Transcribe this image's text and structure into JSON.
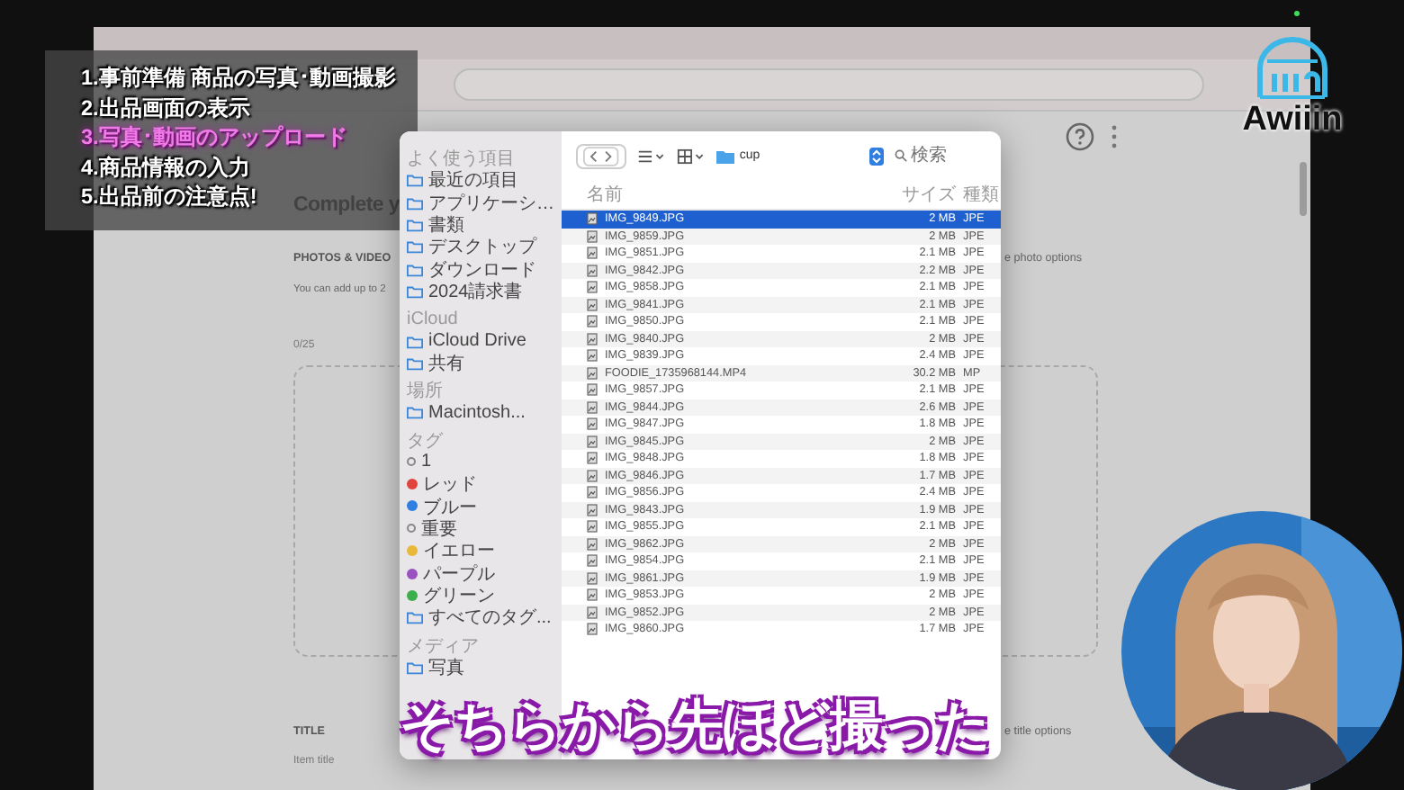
{
  "topics": [
    {
      "label": "1.事前準備 商品の写真･動画撮影",
      "selected": false
    },
    {
      "label": "2.出品画面の表示",
      "selected": false
    },
    {
      "label": "3.写真･動画のアップロード",
      "selected": true
    },
    {
      "label": "4.商品情報の入力",
      "selected": false
    },
    {
      "label": "5.出品前の注意点!",
      "selected": false
    }
  ],
  "logo": {
    "text": "Awiiin"
  },
  "page": {
    "heading": "Complete y",
    "photos_label": "PHOTOS & VIDEO",
    "photos_hint": "You can add up to 2",
    "photos_options": "e photo options",
    "photo_count": "0/25",
    "title_label": "TITLE",
    "title_options": "e title options",
    "title_placeholder": "Item title"
  },
  "dialog": {
    "folder": "cup",
    "search_placeholder": "検索",
    "sidebar": [
      {
        "kind": "header",
        "label": "よく使う項目"
      },
      {
        "kind": "place",
        "label": "最近の項目"
      },
      {
        "kind": "place",
        "label": "アプリケーシ…"
      },
      {
        "kind": "place",
        "label": "書類"
      },
      {
        "kind": "place",
        "label": "デスクトップ"
      },
      {
        "kind": "place",
        "label": "ダウンロード"
      },
      {
        "kind": "place",
        "label": "2024請求書"
      },
      {
        "kind": "header",
        "label": "iCloud"
      },
      {
        "kind": "place",
        "label": "iCloud Drive"
      },
      {
        "kind": "place",
        "label": "共有"
      },
      {
        "kind": "header",
        "label": "場所"
      },
      {
        "kind": "place",
        "label": "Macintosh..."
      },
      {
        "kind": "header",
        "label": "タグ"
      },
      {
        "kind": "tag",
        "label": "1"
      },
      {
        "kind": "tag",
        "label": "レッド",
        "color": "#e0443c"
      },
      {
        "kind": "tag",
        "label": "ブルー",
        "color": "#2f7ee0"
      },
      {
        "kind": "tag",
        "label": "重要"
      },
      {
        "kind": "tag",
        "label": "イエロー",
        "color": "#e8b83a"
      },
      {
        "kind": "tag",
        "label": "パープル",
        "color": "#9a52c0"
      },
      {
        "kind": "tag",
        "label": "グリーン",
        "color": "#3cae4a"
      },
      {
        "kind": "place",
        "label": "すべてのタグ..."
      },
      {
        "kind": "header",
        "label": "メディア"
      },
      {
        "kind": "place",
        "label": "写真"
      }
    ],
    "columns": [
      "名前",
      "サイズ",
      "種類"
    ],
    "files": [
      {
        "name": "IMG_9849.JPG",
        "size": "2 MB",
        "type": "JPE",
        "selected": true
      },
      {
        "name": "IMG_9859.JPG",
        "size": "2 MB",
        "type": "JPE",
        "selected": false
      },
      {
        "name": "IMG_9851.JPG",
        "size": "2.1 MB",
        "type": "JPE",
        "selected": false
      },
      {
        "name": "IMG_9842.JPG",
        "size": "2.2 MB",
        "type": "JPE",
        "selected": false
      },
      {
        "name": "IMG_9858.JPG",
        "size": "2.1 MB",
        "type": "JPE",
        "selected": false
      },
      {
        "name": "IMG_9841.JPG",
        "size": "2.1 MB",
        "type": "JPE",
        "selected": false
      },
      {
        "name": "IMG_9850.JPG",
        "size": "2.1 MB",
        "type": "JPE",
        "selected": false
      },
      {
        "name": "IMG_9840.JPG",
        "size": "2 MB",
        "type": "JPE",
        "selected": false
      },
      {
        "name": "IMG_9839.JPG",
        "size": "2.4 MB",
        "type": "JPE",
        "selected": false
      },
      {
        "name": "FOODIE_1735968144.MP4",
        "size": "30.2 MB",
        "type": "MP",
        "selected": false
      },
      {
        "name": "IMG_9857.JPG",
        "size": "2.1 MB",
        "type": "JPE",
        "selected": false
      },
      {
        "name": "IMG_9844.JPG",
        "size": "2.6 MB",
        "type": "JPE",
        "selected": false
      },
      {
        "name": "IMG_9847.JPG",
        "size": "1.8 MB",
        "type": "JPE",
        "selected": false
      },
      {
        "name": "IMG_9845.JPG",
        "size": "2 MB",
        "type": "JPE",
        "selected": false
      },
      {
        "name": "IMG_9848.JPG",
        "size": "1.8 MB",
        "type": "JPE",
        "selected": false
      },
      {
        "name": "IMG_9846.JPG",
        "size": "1.7 MB",
        "type": "JPE",
        "selected": false
      },
      {
        "name": "IMG_9856.JPG",
        "size": "2.4 MB",
        "type": "JPE",
        "selected": false
      },
      {
        "name": "IMG_9843.JPG",
        "size": "1.9 MB",
        "type": "JPE",
        "selected": false
      },
      {
        "name": "IMG_9855.JPG",
        "size": "2.1 MB",
        "type": "JPE",
        "selected": false
      },
      {
        "name": "IMG_9862.JPG",
        "size": "2 MB",
        "type": "JPE",
        "selected": false
      },
      {
        "name": "IMG_9854.JPG",
        "size": "2.1 MB",
        "type": "JPE",
        "selected": false
      },
      {
        "name": "IMG_9861.JPG",
        "size": "1.9 MB",
        "type": "JPE",
        "selected": false
      },
      {
        "name": "IMG_9853.JPG",
        "size": "2 MB",
        "type": "JPE",
        "selected": false
      },
      {
        "name": "IMG_9852.JPG",
        "size": "2 MB",
        "type": "JPE",
        "selected": false
      },
      {
        "name": "IMG_9860.JPG",
        "size": "1.7 MB",
        "type": "JPE",
        "selected": false
      }
    ]
  },
  "caption": "そちらから先ほど撮った"
}
